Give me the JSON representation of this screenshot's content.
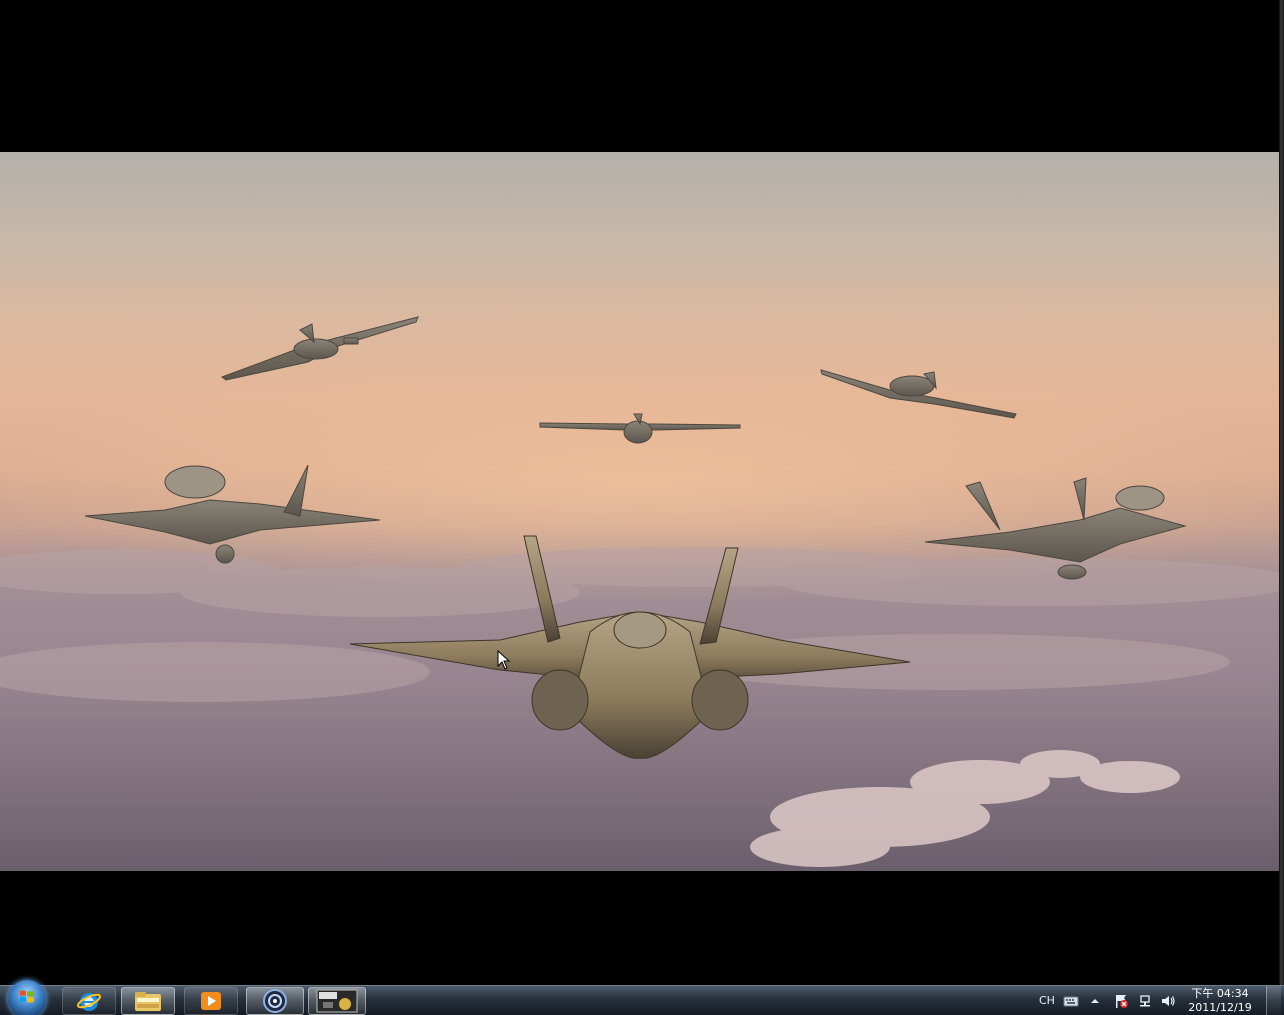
{
  "screen": {
    "video": {
      "description_icon": "fighter-jets-over-clouds-scene"
    }
  },
  "taskbar": {
    "start_button": {
      "icon": "windows-flag-icon"
    },
    "pinned": [
      {
        "id": "ie",
        "icon": "internet-explorer-icon",
        "active": false
      },
      {
        "id": "explorer",
        "icon": "folder-icon",
        "active": true
      },
      {
        "id": "media",
        "icon": "media-player-icon",
        "active": false
      },
      {
        "id": "game",
        "icon": "circular-app-icon",
        "active": true
      },
      {
        "id": "game2",
        "icon": "game-thumbnail-icon",
        "active": true
      }
    ],
    "tray": {
      "language": "CH",
      "icons": [
        "keyboard-icon",
        "show-hidden-icons-arrow",
        "action-center-flag-icon",
        "network-icon",
        "volume-icon"
      ],
      "clock": {
        "time": "下午 04:34",
        "date": "2011/12/19"
      }
    }
  },
  "colors": {
    "taskbar_top": "#4d5b6b",
    "taskbar_bottom": "#161c24",
    "sky_top": "#b3b0aa",
    "sky_horizon": "#e5b697",
    "clouds": "#7d6f7b"
  }
}
